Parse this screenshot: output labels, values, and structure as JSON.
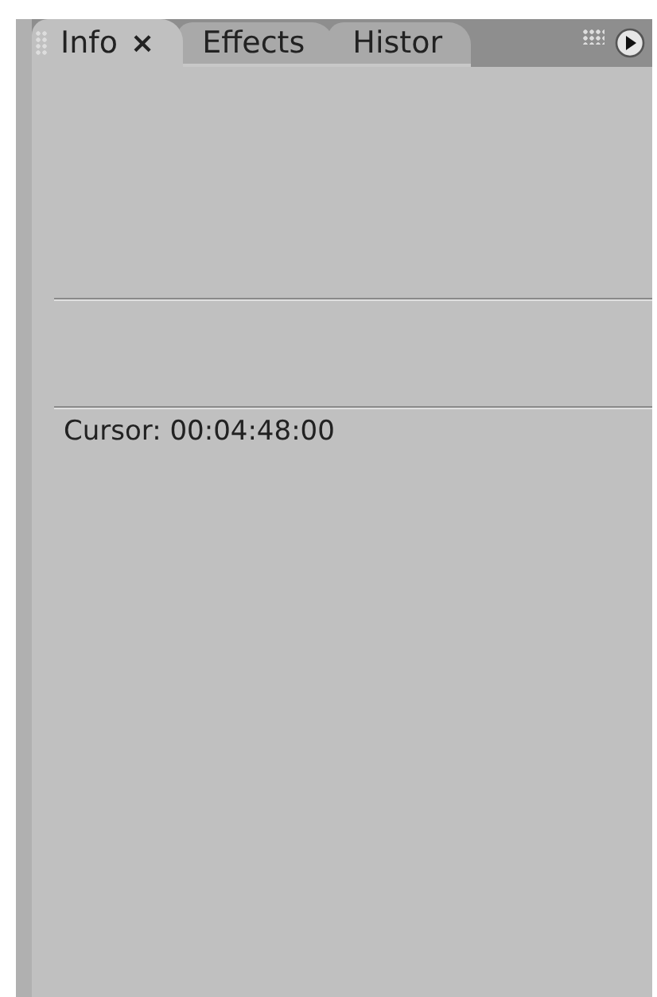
{
  "tabs": [
    {
      "label": "Info",
      "selected": true,
      "close": "×"
    },
    {
      "label": "Effects",
      "selected": false
    },
    {
      "label": "Histor",
      "selected": false
    }
  ],
  "info": {
    "cursor": "Cursor: 00:04:48:00"
  }
}
